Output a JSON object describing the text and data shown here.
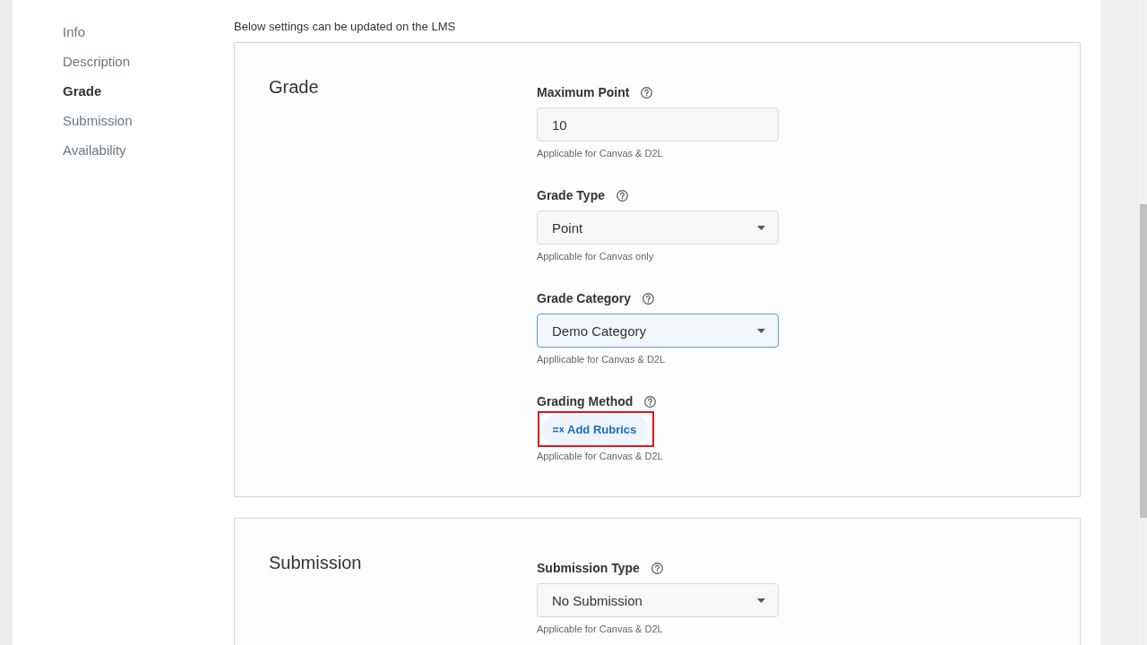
{
  "sidebar": {
    "items": [
      {
        "label": "Info",
        "selected": false
      },
      {
        "label": "Description",
        "selected": false
      },
      {
        "label": "Grade",
        "selected": true
      },
      {
        "label": "Submission",
        "selected": false
      },
      {
        "label": "Availability",
        "selected": false
      }
    ]
  },
  "note": "Below settings can be updated on the LMS",
  "sections": [
    {
      "title": "Grade",
      "fields": [
        {
          "kind": "input",
          "label": "Maximum Point",
          "value": "10",
          "hint": "Applicable for Canvas & D2L",
          "focused": false
        },
        {
          "kind": "select",
          "label": "Grade Type",
          "value": "Point",
          "hint": "Applicable for Canvas only",
          "focused": false
        },
        {
          "kind": "select",
          "label": "Grade Category",
          "value": "Demo Category",
          "hint": "Appllicable for Canvas & D2L",
          "focused": true
        },
        {
          "kind": "button",
          "label": "Grading Method",
          "button": "Add Rubrics",
          "hint": "Applicable for Canvas & D2L",
          "highlighted": true
        }
      ]
    },
    {
      "title": "Submission",
      "fields": [
        {
          "kind": "select",
          "label": "Submission Type",
          "value": "No Submission",
          "hint": "Applicable for Canvas & D2L",
          "focused": false
        }
      ]
    }
  ]
}
